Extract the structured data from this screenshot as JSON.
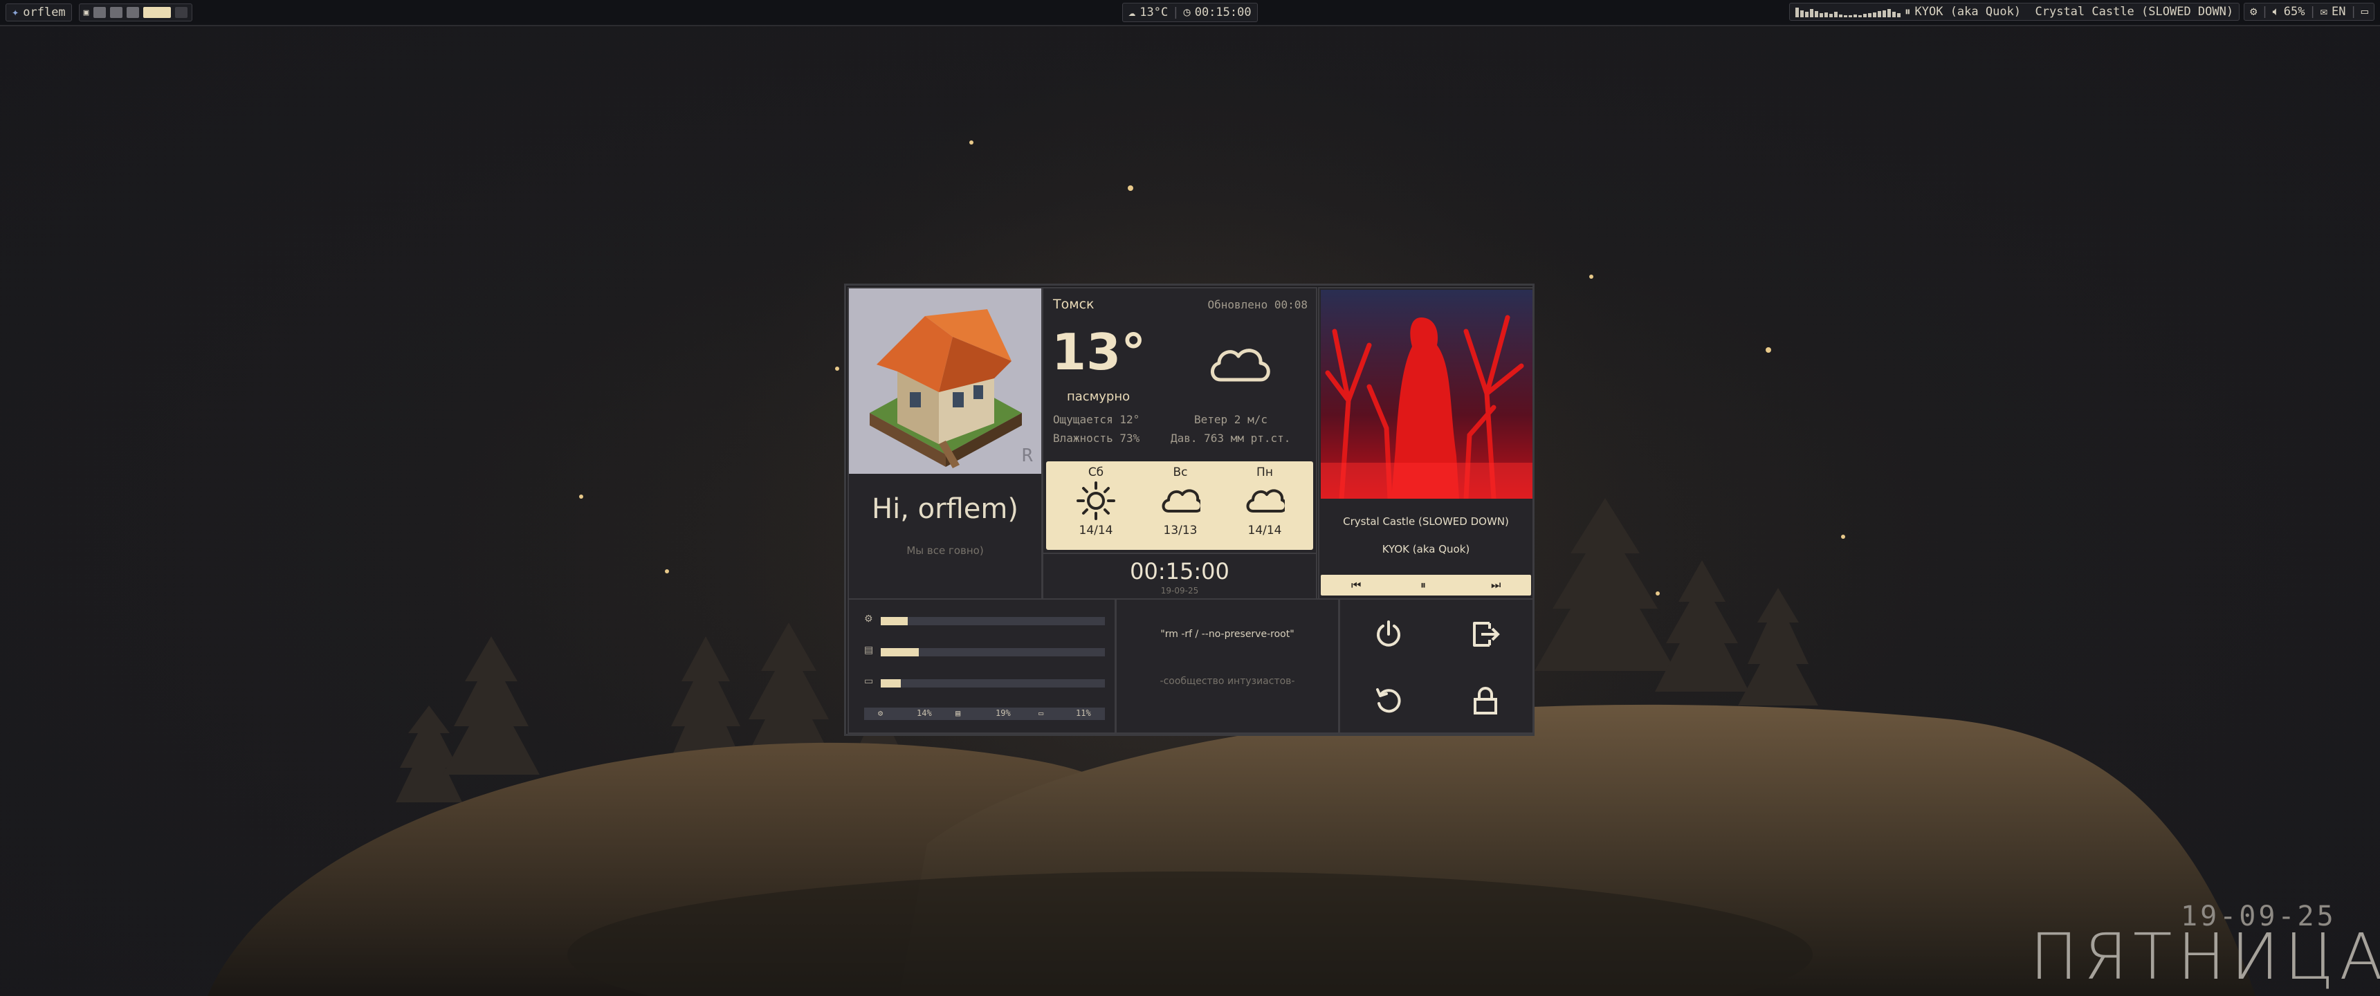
{
  "topbar": {
    "username": "orflem",
    "weather": "13°C",
    "clock": "00:15:00",
    "now_playing": "KYOK (aka Quok)  Crystal Castle (SLOWED DOWN)",
    "volume": "65%",
    "layout": "EN",
    "icons": [
      "apple-logo-icon",
      "window-icon",
      "cloud-icon",
      "clock-icon",
      "pause-icon",
      "gear-icon",
      "speaker-icon",
      "envelope-icon",
      "battery-icon"
    ]
  },
  "profile": {
    "greeting": "Hi, orflem)",
    "subtitle": "Мы все говно)"
  },
  "weather": {
    "city": "Томск",
    "updated": "Обновлено 00:08",
    "temperature": "13°",
    "condition": "пасмурно",
    "feels_like": "Ощущается 12°",
    "wind": "Ветер 2 м/с",
    "humidity": "Влажность 73%",
    "pressure": "Дав. 763 мм рт.ст.",
    "forecast": [
      {
        "day": "Сб",
        "temps": "14/14",
        "icon": "sun-icon"
      },
      {
        "day": "Вс",
        "temps": "13/13",
        "icon": "cloud-icon"
      },
      {
        "day": "Пн",
        "temps": "14/14",
        "icon": "cloud-icon"
      }
    ]
  },
  "clock": {
    "time": "00:15:00",
    "date": "19-09-25"
  },
  "music": {
    "title": "Crystal Castle (SLOWED DOWN)",
    "artist": "KYOK (aka Quok)"
  },
  "stats": {
    "bars": [
      {
        "icon": "gear-icon",
        "fraction": 0.12
      },
      {
        "icon": "memory-icon",
        "fraction": 0.17
      },
      {
        "icon": "disk-icon",
        "fraction": 0.09
      }
    ],
    "summary": [
      "14%",
      "19%",
      "11%"
    ]
  },
  "terminal": {
    "command": "\"rm -rf / --no-preserve-root\"",
    "caption": "-сообщество интузиастов-"
  },
  "power": {
    "icons": [
      "power-icon",
      "logout-icon",
      "restart-icon",
      "lock-icon"
    ]
  },
  "desktop": {
    "date": "19-09-25",
    "day": "ПЯТНИЦА"
  },
  "colors": {
    "accent": "#eadbb2",
    "background": "#1d1c1e",
    "panel": "#262529"
  }
}
